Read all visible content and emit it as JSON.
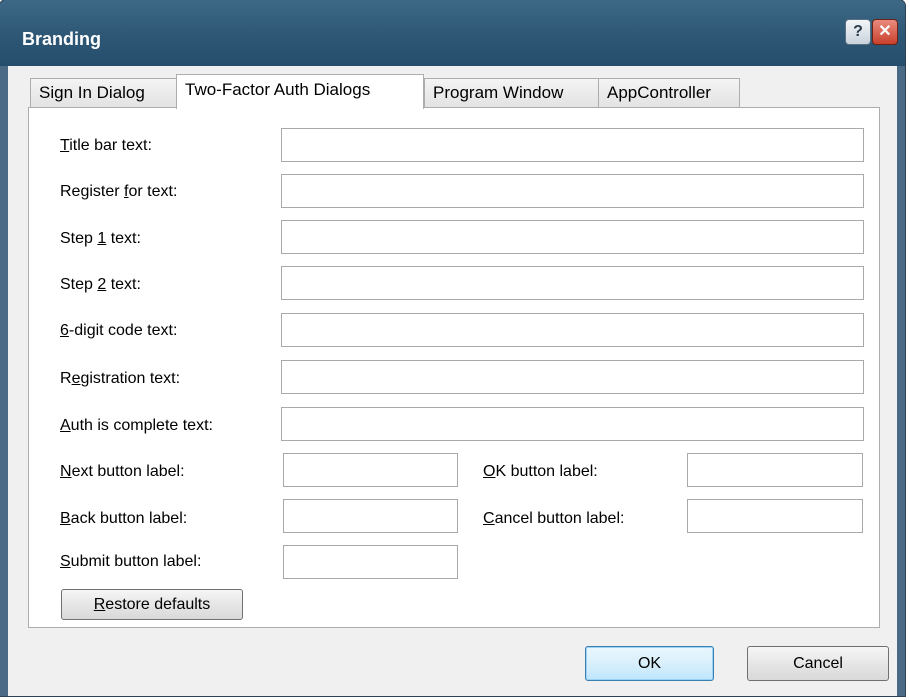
{
  "window": {
    "title": "Branding",
    "help_glyph": "?",
    "close_glyph": "✕"
  },
  "tabs": [
    {
      "label": "Sign In Dialog",
      "active": false
    },
    {
      "label": "Two-Factor Auth Dialogs",
      "active": true
    },
    {
      "label": "Program Window",
      "active": false
    },
    {
      "label": "AppController",
      "active": false
    }
  ],
  "fields": {
    "title_bar_text": {
      "label_prefix": "",
      "label_accel": "T",
      "label_rest": "itle bar text:",
      "value": ""
    },
    "register_for_text": {
      "label_prefix": "Register ",
      "label_accel": "f",
      "label_rest": "or text:",
      "value": ""
    },
    "step1_text": {
      "label_prefix": "Step ",
      "label_accel": "1",
      "label_rest": " text:",
      "value": ""
    },
    "step2_text": {
      "label_prefix": "Step ",
      "label_accel": "2",
      "label_rest": " text:",
      "value": ""
    },
    "six_digit_code_text": {
      "label_prefix": "",
      "label_accel": "6",
      "label_rest": "-digit code text:",
      "value": ""
    },
    "registration_text": {
      "label_prefix": "R",
      "label_accel": "e",
      "label_rest": "gistration text:",
      "value": ""
    },
    "auth_complete_text": {
      "label_prefix": "",
      "label_accel": "A",
      "label_rest": "uth is complete text:",
      "value": ""
    },
    "next_button_label": {
      "label_prefix": "",
      "label_accel": "N",
      "label_rest": "ext button label:",
      "value": ""
    },
    "back_button_label": {
      "label_prefix": "",
      "label_accel": "B",
      "label_rest": "ack button label:",
      "value": ""
    },
    "submit_button_label": {
      "label_prefix": "",
      "label_accel": "S",
      "label_rest": "ubmit button label:",
      "value": ""
    },
    "ok_button_label": {
      "label_prefix": "",
      "label_accel": "O",
      "label_rest": "K button label:",
      "value": ""
    },
    "cancel_button_label": {
      "label_prefix": "",
      "label_accel": "C",
      "label_rest": "ancel button label:",
      "value": ""
    }
  },
  "restore": {
    "label_accel": "R",
    "label_rest": "estore defaults"
  },
  "footer": {
    "ok_label": "OK",
    "cancel_label": "Cancel"
  }
}
